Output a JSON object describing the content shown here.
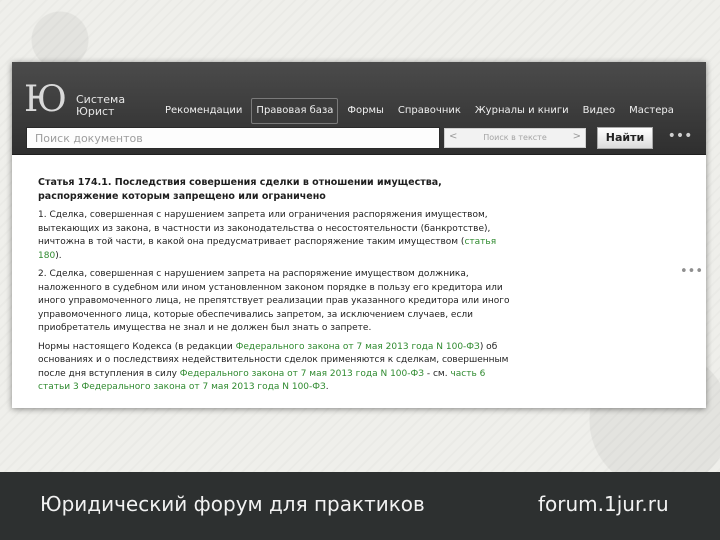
{
  "app": {
    "logo_mark": "Ю",
    "logo_line1": "Система",
    "logo_line2": "Юрист"
  },
  "nav": {
    "items": [
      {
        "label": "Рекомендации"
      },
      {
        "label": "Правовая база"
      },
      {
        "label": "Формы"
      },
      {
        "label": "Справочник"
      },
      {
        "label": "Журналы и книги"
      },
      {
        "label": "Видео"
      },
      {
        "label": "Мастера"
      }
    ],
    "active_index": 1
  },
  "search": {
    "placeholder": "Поиск документов",
    "context_prev": "<",
    "context_label": "Поиск в тексте",
    "context_next": ">",
    "find_label": "Найти",
    "more_label": "•••"
  },
  "article": {
    "title": "Статья 174.1. Последствия совершения сделки в отношении имущества, распоряжение которым запрещено или ограничено",
    "p1_text": "1. Сделка, совершенная с нарушением запрета или ограничения распоряжения имуществом, вытекающих из закона, в частности из законодательства о несостоятельности (банкротстве), ничтожна в той части, в какой она предусматривает распоряжение таким имуществом (",
    "p1_link": "статья 180",
    "p1_end": ").",
    "p2_text": "2. Сделка, совершенная с нарушением запрета на распоряжение имуществом должника, наложенного в судебном или ином установленном законом порядке в пользу его кредитора или иного управомоченного лица, не препятствует реализации прав указанного кредитора или иного управомоченного лица, которые обеспечивались запретом, за исключением случаев, если приобретатель имущества не знал и не должен был знать о запрете.",
    "note_a": "Нормы настоящего Кодекса (в редакции ",
    "note_link1": "Федерального закона от 7 мая 2013 года N 100-ФЗ",
    "note_b": ") об основаниях и о последствиях недействительности сделок применяются к сделкам, совершенным после дня вступления в силу ",
    "note_link2": "Федерального закона от 7 мая 2013 года N 100-ФЗ",
    "note_c": " - см. ",
    "note_link3": "часть 6 статьи 3 Федерального закона от 7 мая 2013 года N 100-ФЗ",
    "note_d": "."
  },
  "side": {
    "dots": "•••"
  },
  "footer": {
    "slogan": "Юридический форум для практиков",
    "site": "forum.1jur.ru"
  },
  "colors": {
    "header_bg": "#3d3d3d",
    "link_green": "#2f8a2f",
    "footer_bg": "#2d3030"
  }
}
